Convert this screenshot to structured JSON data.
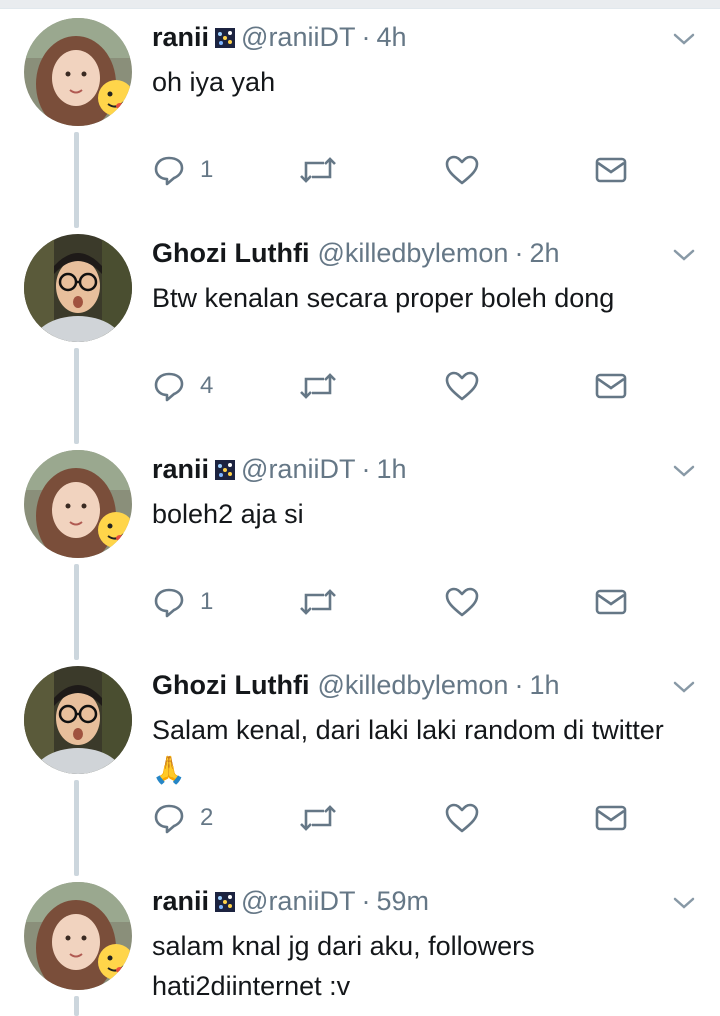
{
  "tweets": [
    {
      "name": "ranii",
      "handle": "@raniiDT",
      "time": "4h",
      "text": "oh iya yah",
      "reply_count": "1",
      "avatar": "user-ranii-avatar"
    },
    {
      "name": "Ghozi Luthfi",
      "handle": "@killedbylemon",
      "time": "2h",
      "text": "Btw kenalan secara proper boleh dong",
      "reply_count": "4",
      "avatar": "user-ghozi-avatar"
    },
    {
      "name": "ranii",
      "handle": "@raniiDT",
      "time": "1h",
      "text": "boleh2 aja si",
      "reply_count": "1",
      "avatar": "user-ranii-avatar"
    },
    {
      "name": "Ghozi Luthfi",
      "handle": "@killedbylemon",
      "time": "1h",
      "text": "Salam kenal, dari laki laki random di twitter 🙏",
      "reply_count": "2",
      "avatar": "user-ghozi-avatar"
    },
    {
      "name": "ranii",
      "handle": "@raniiDT",
      "time": "59m",
      "text": "salam knal jg dari aku, followers hati2diinternet :v",
      "reply_count": "",
      "avatar": "user-ranii-avatar"
    }
  ],
  "icons": {
    "reply": "reply-icon",
    "retweet": "retweet-icon",
    "like": "heart-icon",
    "dm": "envelope-icon",
    "caret": "chevron-down-icon"
  },
  "colors": {
    "text": "#14171a",
    "secondary": "#657786",
    "thread_line": "#ccd6dd"
  }
}
